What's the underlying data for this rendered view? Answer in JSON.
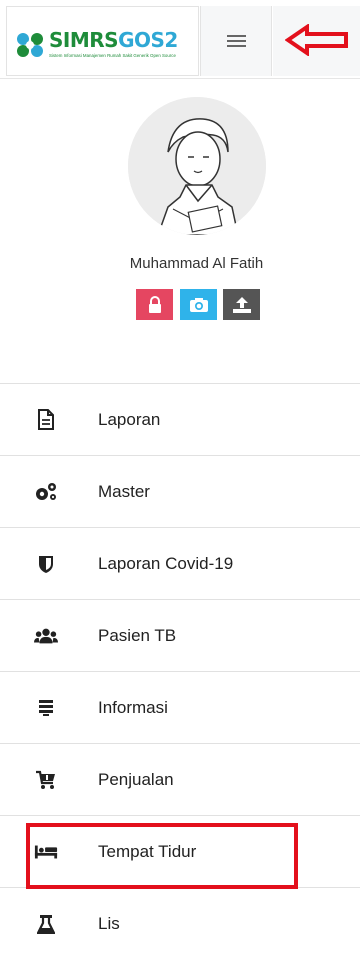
{
  "header": {
    "logo_text_part1": "SIMRS",
    "logo_text_part2": "GOS2",
    "logo_subtitle": "Sistem Informasi Manajemen Rumah Sakit Generik Open Source",
    "menu_toggle_icon": "hamburger-icon",
    "annotation_arrow_color": "#e3101c"
  },
  "profile": {
    "name": "Muhammad Al Fatih",
    "actions": [
      {
        "icon": "lock-icon",
        "color": "#e54661"
      },
      {
        "icon": "camera-icon",
        "color": "#2fb3ea"
      },
      {
        "icon": "upload-icon",
        "color": "#555555"
      }
    ]
  },
  "menu": {
    "items": [
      {
        "label": "Laporan",
        "icon": "file-text-icon"
      },
      {
        "label": "Master",
        "icon": "cogs-icon"
      },
      {
        "label": "Laporan Covid-19",
        "icon": "shield-icon"
      },
      {
        "label": "Pasien TB",
        "icon": "users-icon"
      },
      {
        "label": "Informasi",
        "icon": "list-icon"
      },
      {
        "label": "Penjualan",
        "icon": "cart-icon"
      },
      {
        "label": "Tempat Tidur",
        "icon": "bed-icon",
        "highlighted": true
      },
      {
        "label": "Lis",
        "icon": "flask-icon"
      }
    ]
  },
  "highlight_color": "#e3101c"
}
